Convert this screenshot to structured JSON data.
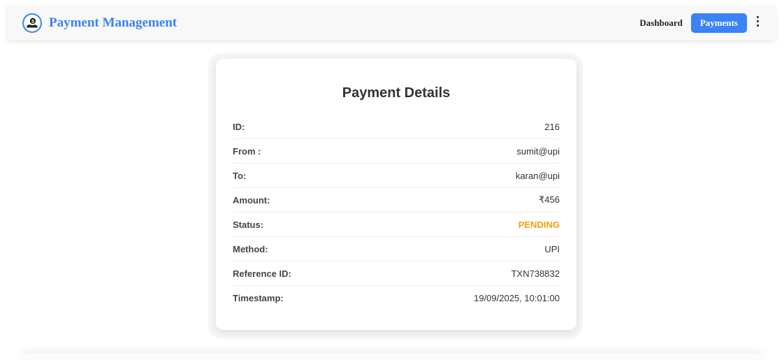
{
  "navbar": {
    "title": "Payment Management",
    "logo_icon": "money-hand-icon",
    "links": [
      {
        "label": "Dashboard",
        "active": false
      },
      {
        "label": "Payments",
        "active": true
      }
    ],
    "more_icon": "vertical-ellipsis-icon",
    "accent_color": "#3b82f6"
  },
  "details": {
    "title": "Payment Details",
    "status_color": "#f59e0b",
    "rows": [
      {
        "label": "ID:",
        "value": "216"
      },
      {
        "label": "From :",
        "value": "sumit@upi"
      },
      {
        "label": "To:",
        "value": "karan@upi"
      },
      {
        "label": "Amount:",
        "value": "₹456"
      },
      {
        "label": "Status:",
        "value": "PENDING"
      },
      {
        "label": "Method:",
        "value": "UPI"
      },
      {
        "label": "Reference ID:",
        "value": "TXN738832"
      },
      {
        "label": "Timestamp:",
        "value": "19/09/2025, 10:01:00"
      }
    ]
  }
}
